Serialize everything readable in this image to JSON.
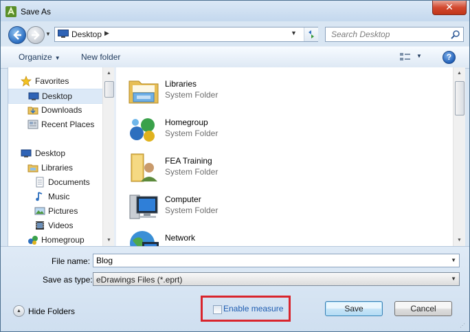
{
  "window": {
    "title": "Save As",
    "close_label": "✕"
  },
  "address_bar": {
    "location": "Desktop"
  },
  "search": {
    "placeholder": "Search Desktop"
  },
  "toolbar": {
    "organize_label": "Organize",
    "new_folder_label": "New folder",
    "help_label": "?"
  },
  "nav_pane": {
    "items": [
      {
        "label": "Favorites",
        "icon": "star-icon",
        "selected": false
      },
      {
        "label": "Desktop",
        "icon": "desktop-icon",
        "selected": true
      },
      {
        "label": "Downloads",
        "icon": "downloads-icon",
        "selected": false
      },
      {
        "label": "Recent Places",
        "icon": "recent-places-icon",
        "selected": false
      },
      {
        "label": "Desktop",
        "icon": "desktop-icon",
        "selected": false
      },
      {
        "label": "Libraries",
        "icon": "libraries-icon",
        "selected": false
      },
      {
        "label": "Documents",
        "icon": "documents-icon",
        "selected": false
      },
      {
        "label": "Music",
        "icon": "music-icon",
        "selected": false
      },
      {
        "label": "Pictures",
        "icon": "pictures-icon",
        "selected": false
      },
      {
        "label": "Videos",
        "icon": "videos-icon",
        "selected": false
      },
      {
        "label": "Homegroup",
        "icon": "homegroup-icon",
        "selected": false
      }
    ]
  },
  "files": [
    {
      "name": "Libraries",
      "type": "System Folder",
      "icon": "libraries-folder-icon"
    },
    {
      "name": "Homegroup",
      "type": "System Folder",
      "icon": "homegroup-icon"
    },
    {
      "name": "FEA Training",
      "type": "System Folder",
      "icon": "user-folder-icon"
    },
    {
      "name": "Computer",
      "type": "System Folder",
      "icon": "computer-icon"
    },
    {
      "name": "Network",
      "type": "",
      "icon": "network-icon"
    }
  ],
  "form": {
    "file_name_label": "File name:",
    "file_name_value": "Blog",
    "save_type_label": "Save as type:",
    "save_type_value": "eDrawings Files (*.eprt)",
    "hide_folders_label": "Hide Folders",
    "enable_measure_label": "Enable measure",
    "enable_measure_checked": false,
    "save_label": "Save",
    "cancel_label": "Cancel"
  },
  "colors": {
    "highlight_box": "#d9242c",
    "link_blue": "#1c5bb0",
    "close_red": "#c03619"
  }
}
